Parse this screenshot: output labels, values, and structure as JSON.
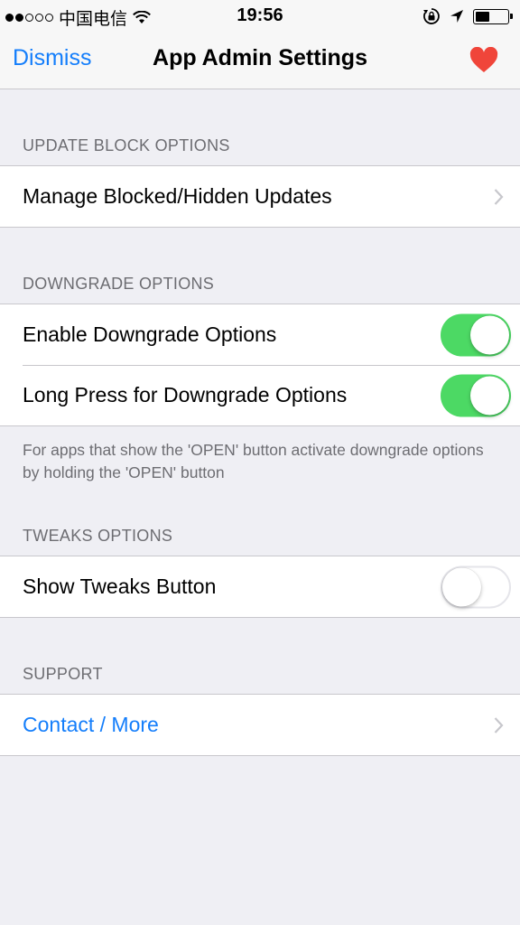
{
  "status_bar": {
    "carrier": "中国电信",
    "time": "19:56",
    "signal_bars": 2,
    "signal_total": 5,
    "battery_level": 0.45
  },
  "nav": {
    "dismiss_label": "Dismiss",
    "title": "App Admin Settings",
    "right_icon": "heart-icon",
    "heart_color": "#f0453a"
  },
  "sections": {
    "update_block": {
      "header": "UPDATE BLOCK OPTIONS",
      "rows": [
        {
          "label": "Manage Blocked/Hidden Updates"
        }
      ]
    },
    "downgrade": {
      "header": "DOWNGRADE OPTIONS",
      "rows": [
        {
          "label": "Enable Downgrade Options",
          "on": true
        },
        {
          "label": "Long Press for Downgrade Options",
          "on": true
        }
      ],
      "footer": "For apps that show the 'OPEN' button activate downgrade options by holding the 'OPEN' button"
    },
    "tweaks": {
      "header": "TWEAKS OPTIONS",
      "rows": [
        {
          "label": "Show Tweaks Button",
          "on": false
        }
      ]
    },
    "support": {
      "header": "SUPPORT",
      "rows": [
        {
          "label": "Contact / More"
        }
      ]
    }
  },
  "colors": {
    "accent": "#147efb",
    "toggle_on": "#4cd964",
    "background": "#efeff4"
  }
}
